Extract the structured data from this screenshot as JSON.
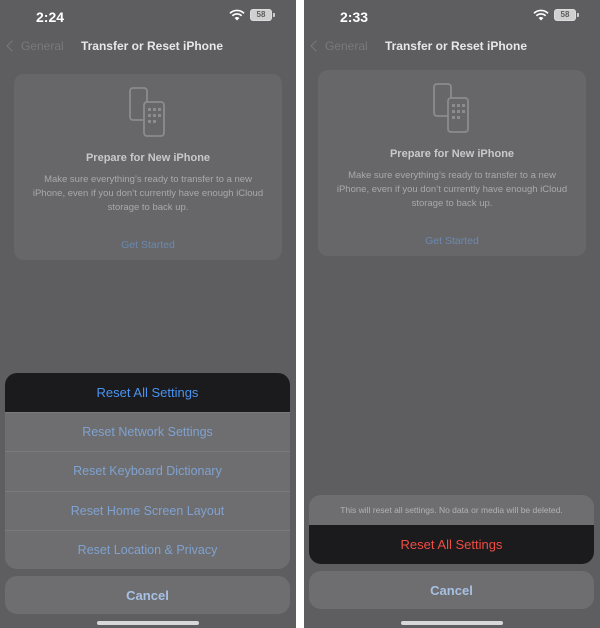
{
  "left": {
    "status": {
      "time": "2:24",
      "battery": "58"
    },
    "nav": {
      "back": "General",
      "title": "Transfer or Reset iPhone"
    },
    "card": {
      "title": "Prepare for New iPhone",
      "description": "Make sure everything’s ready to transfer to a new iPhone, even if you don’t currently have enough iCloud storage to back up.",
      "link": "Get Started"
    },
    "actions": [
      "Reset All Settings",
      "Reset Network Settings",
      "Reset Keyboard Dictionary",
      "Reset Home Screen Layout",
      "Reset Location & Privacy"
    ],
    "cancel": "Cancel"
  },
  "right": {
    "status": {
      "time": "2:33",
      "battery": "58"
    },
    "nav": {
      "back": "General",
      "title": "Transfer or Reset iPhone"
    },
    "card": {
      "title": "Prepare for New iPhone",
      "description": "Make sure everything’s ready to transfer to a new iPhone, even if you don’t currently have enough iCloud storage to back up.",
      "link": "Get Started"
    },
    "confirm": {
      "message": "This will reset all settings. No data or media will be deleted.",
      "action": "Reset All Settings"
    },
    "cancel": "Cancel"
  },
  "colors": {
    "dimmed_background": "#5e5e60",
    "highlight_blue": "#4a93f0",
    "destructive_red": "#ef4c43"
  }
}
